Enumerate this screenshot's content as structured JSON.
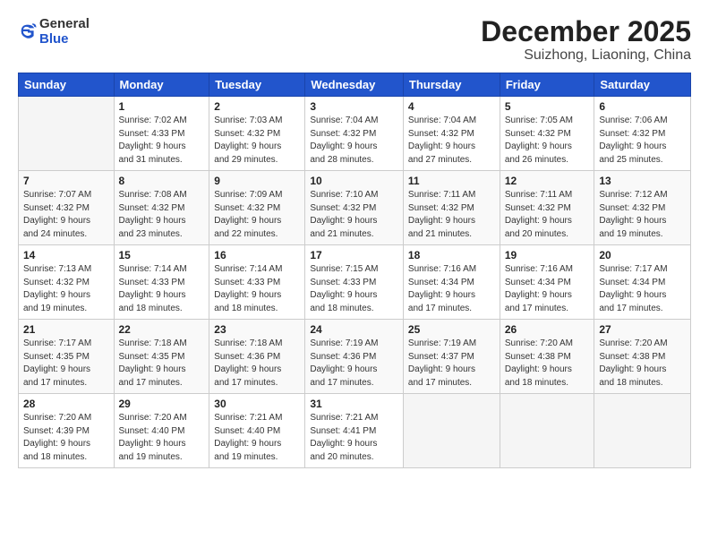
{
  "header": {
    "logo_general": "General",
    "logo_blue": "Blue",
    "title": "December 2025",
    "subtitle": "Suizhong, Liaoning, China"
  },
  "columns": [
    "Sunday",
    "Monday",
    "Tuesday",
    "Wednesday",
    "Thursday",
    "Friday",
    "Saturday"
  ],
  "weeks": [
    [
      {
        "day": "",
        "info": ""
      },
      {
        "day": "1",
        "info": "Sunrise: 7:02 AM\nSunset: 4:33 PM\nDaylight: 9 hours\nand 31 minutes."
      },
      {
        "day": "2",
        "info": "Sunrise: 7:03 AM\nSunset: 4:32 PM\nDaylight: 9 hours\nand 29 minutes."
      },
      {
        "day": "3",
        "info": "Sunrise: 7:04 AM\nSunset: 4:32 PM\nDaylight: 9 hours\nand 28 minutes."
      },
      {
        "day": "4",
        "info": "Sunrise: 7:04 AM\nSunset: 4:32 PM\nDaylight: 9 hours\nand 27 minutes."
      },
      {
        "day": "5",
        "info": "Sunrise: 7:05 AM\nSunset: 4:32 PM\nDaylight: 9 hours\nand 26 minutes."
      },
      {
        "day": "6",
        "info": "Sunrise: 7:06 AM\nSunset: 4:32 PM\nDaylight: 9 hours\nand 25 minutes."
      }
    ],
    [
      {
        "day": "7",
        "info": "Sunrise: 7:07 AM\nSunset: 4:32 PM\nDaylight: 9 hours\nand 24 minutes."
      },
      {
        "day": "8",
        "info": "Sunrise: 7:08 AM\nSunset: 4:32 PM\nDaylight: 9 hours\nand 23 minutes."
      },
      {
        "day": "9",
        "info": "Sunrise: 7:09 AM\nSunset: 4:32 PM\nDaylight: 9 hours\nand 22 minutes."
      },
      {
        "day": "10",
        "info": "Sunrise: 7:10 AM\nSunset: 4:32 PM\nDaylight: 9 hours\nand 21 minutes."
      },
      {
        "day": "11",
        "info": "Sunrise: 7:11 AM\nSunset: 4:32 PM\nDaylight: 9 hours\nand 21 minutes."
      },
      {
        "day": "12",
        "info": "Sunrise: 7:11 AM\nSunset: 4:32 PM\nDaylight: 9 hours\nand 20 minutes."
      },
      {
        "day": "13",
        "info": "Sunrise: 7:12 AM\nSunset: 4:32 PM\nDaylight: 9 hours\nand 19 minutes."
      }
    ],
    [
      {
        "day": "14",
        "info": "Sunrise: 7:13 AM\nSunset: 4:32 PM\nDaylight: 9 hours\nand 19 minutes."
      },
      {
        "day": "15",
        "info": "Sunrise: 7:14 AM\nSunset: 4:33 PM\nDaylight: 9 hours\nand 18 minutes."
      },
      {
        "day": "16",
        "info": "Sunrise: 7:14 AM\nSunset: 4:33 PM\nDaylight: 9 hours\nand 18 minutes."
      },
      {
        "day": "17",
        "info": "Sunrise: 7:15 AM\nSunset: 4:33 PM\nDaylight: 9 hours\nand 18 minutes."
      },
      {
        "day": "18",
        "info": "Sunrise: 7:16 AM\nSunset: 4:34 PM\nDaylight: 9 hours\nand 17 minutes."
      },
      {
        "day": "19",
        "info": "Sunrise: 7:16 AM\nSunset: 4:34 PM\nDaylight: 9 hours\nand 17 minutes."
      },
      {
        "day": "20",
        "info": "Sunrise: 7:17 AM\nSunset: 4:34 PM\nDaylight: 9 hours\nand 17 minutes."
      }
    ],
    [
      {
        "day": "21",
        "info": "Sunrise: 7:17 AM\nSunset: 4:35 PM\nDaylight: 9 hours\nand 17 minutes."
      },
      {
        "day": "22",
        "info": "Sunrise: 7:18 AM\nSunset: 4:35 PM\nDaylight: 9 hours\nand 17 minutes."
      },
      {
        "day": "23",
        "info": "Sunrise: 7:18 AM\nSunset: 4:36 PM\nDaylight: 9 hours\nand 17 minutes."
      },
      {
        "day": "24",
        "info": "Sunrise: 7:19 AM\nSunset: 4:36 PM\nDaylight: 9 hours\nand 17 minutes."
      },
      {
        "day": "25",
        "info": "Sunrise: 7:19 AM\nSunset: 4:37 PM\nDaylight: 9 hours\nand 17 minutes."
      },
      {
        "day": "26",
        "info": "Sunrise: 7:20 AM\nSunset: 4:38 PM\nDaylight: 9 hours\nand 18 minutes."
      },
      {
        "day": "27",
        "info": "Sunrise: 7:20 AM\nSunset: 4:38 PM\nDaylight: 9 hours\nand 18 minutes."
      }
    ],
    [
      {
        "day": "28",
        "info": "Sunrise: 7:20 AM\nSunset: 4:39 PM\nDaylight: 9 hours\nand 18 minutes."
      },
      {
        "day": "29",
        "info": "Sunrise: 7:20 AM\nSunset: 4:40 PM\nDaylight: 9 hours\nand 19 minutes."
      },
      {
        "day": "30",
        "info": "Sunrise: 7:21 AM\nSunset: 4:40 PM\nDaylight: 9 hours\nand 19 minutes."
      },
      {
        "day": "31",
        "info": "Sunrise: 7:21 AM\nSunset: 4:41 PM\nDaylight: 9 hours\nand 20 minutes."
      },
      {
        "day": "",
        "info": ""
      },
      {
        "day": "",
        "info": ""
      },
      {
        "day": "",
        "info": ""
      }
    ]
  ]
}
